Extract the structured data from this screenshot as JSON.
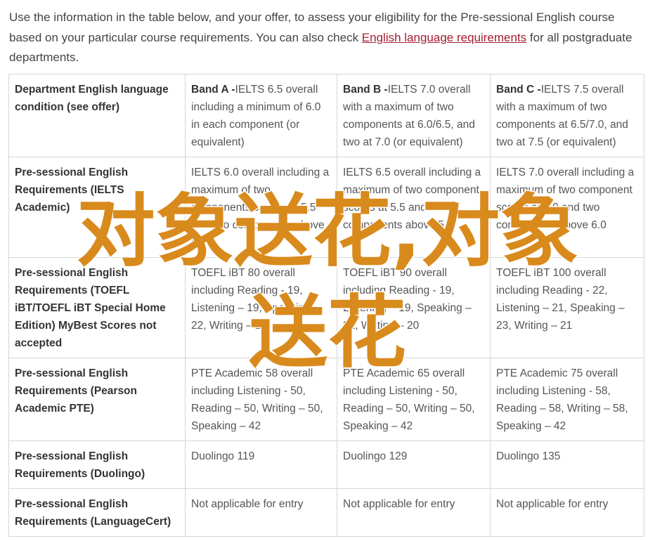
{
  "intro": {
    "text_before": "Use the information in the table below, and your offer, to assess your eligibility for the Pre-sessional English course based on your particular course requirements. You can also check ",
    "link_text": "English language requirements",
    "text_after": " for all postgraduate departments."
  },
  "table": {
    "header": {
      "label": "Department English language condition (see offer)",
      "bands": [
        {
          "name": "Band A -",
          "desc": "IELTS 6.5 overall including a minimum of 6.0 in each component (or equivalent)"
        },
        {
          "name": "Band B -",
          "desc": "IELTS 7.0 overall with a maximum of two components at 6.0/6.5, and two at 7.0 (or equivalent)"
        },
        {
          "name": "Band C -",
          "desc": "IELTS 7.5 overall with a maximum of two components at 6.5/7.0, and two at 7.5 (or equivalent)"
        }
      ]
    },
    "rows": [
      {
        "label": "Pre-sessional English Requirements (IELTS Academic)",
        "cells": [
          "IELTS 6.0 overall including a maximum of two components scores at 5.5 and two components above 5.5",
          "IELTS 6.5 overall including a maximum of two component scores at 5.5 and two components above 5.5",
          "IELTS 7.0 overall including a maximum of two component scores at 6.0 and two components above 6.0"
        ]
      },
      {
        "label": "Pre-sessional English Requirements (TOEFL iBT/TOEFL iBT Special Home Edition) MyBest Scores not accepted",
        "cells": [
          "TOEFL iBT 80 overall including Reading - 19, Listening – 19, Speaking – 22, Writing – 20",
          "TOEFL iBT 90 overall including Reading - 19, Listening – 19, Speaking – 22, Writing – 20",
          "TOEFL iBT 100 overall including Reading - 22, Listening – 21, Speaking – 23, Writing – 21"
        ]
      },
      {
        "label": "Pre-sessional English Requirements (Pearson Academic PTE)",
        "cells": [
          "PTE Academic 58 overall including Listening - 50, Reading – 50, Writing – 50, Speaking – 42",
          "PTE Academic 65 overall including Listening - 50, Reading – 50, Writing – 50, Speaking – 42",
          "PTE Academic 75 overall including Listening - 58, Reading – 58, Writing – 58, Speaking – 42"
        ]
      },
      {
        "label": "Pre-sessional English Requirements (Duolingo)",
        "cells": [
          "Duolingo 119",
          "Duolingo 129",
          "Duolingo 135"
        ]
      },
      {
        "label": "Pre-sessional English Requirements (LanguageCert)",
        "cells": [
          "Not applicable for entry",
          "Not applicable for entry",
          "Not applicable for entry"
        ]
      }
    ]
  },
  "watermark": {
    "line1": "对象送花,对象",
    "line2": "送花",
    "color": "#d98a1c"
  }
}
